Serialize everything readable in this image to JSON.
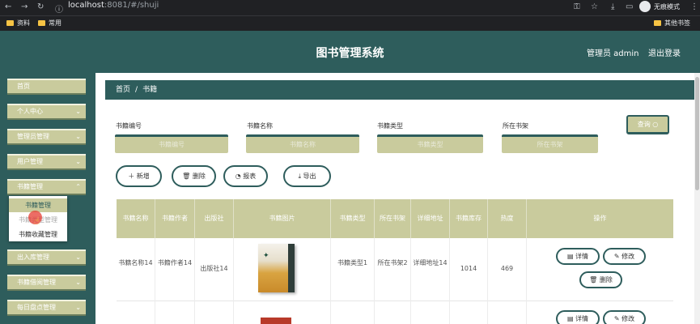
{
  "browser": {
    "url_host": "localhost",
    "url_rest": ":8081/#/shuji",
    "profile_mode": "无痕模式",
    "bookmarks": [
      "资料",
      "常用"
    ],
    "other_bookmarks": "其他书签"
  },
  "header": {
    "title": "图书管理系统",
    "admin": "管理员 admin",
    "logout": "退出登录"
  },
  "sidebar": {
    "items": [
      {
        "label": "首页"
      },
      {
        "label": "个人中心"
      },
      {
        "label": "管理员管理"
      },
      {
        "label": "用户管理"
      },
      {
        "label": "书籍管理"
      },
      {
        "label": "出入库管理"
      },
      {
        "label": "书籍借阅管理"
      },
      {
        "label": "每日盘点管理"
      }
    ],
    "submenu": [
      "书籍管理",
      "书籍类型管理",
      "书籍收藏管理"
    ]
  },
  "breadcrumb": {
    "home": "首页",
    "sep": "/",
    "current": "书籍"
  },
  "filters": {
    "book_no": {
      "label": "书籍编号",
      "placeholder": "书籍编号"
    },
    "book_name": {
      "label": "书籍名称",
      "placeholder": "书籍名称"
    },
    "book_type": {
      "label": "书籍类型",
      "placeholder": "书籍类型"
    },
    "shelf": {
      "label": "所在书架",
      "placeholder": "所在书架"
    },
    "search": "查询"
  },
  "actions": {
    "add": "新增",
    "delete": "删除",
    "report": "报表",
    "export": "导出"
  },
  "table": {
    "headers": [
      "书籍名称",
      "书籍作者",
      "出版社",
      "书籍图片",
      "书籍类型",
      "所在书架",
      "详细地址",
      "书籍库存",
      "热度",
      "操作"
    ],
    "rows": [
      {
        "name": "书籍名称14",
        "author": "书籍作者14",
        "publisher": "出版社14",
        "type": "书籍类型1",
        "shelf": "所在书架2",
        "address": "详细地址14",
        "stock": "1014",
        "heat": "469"
      }
    ],
    "ops": {
      "detail": "详情",
      "edit": "修改",
      "delete": "删除"
    }
  }
}
